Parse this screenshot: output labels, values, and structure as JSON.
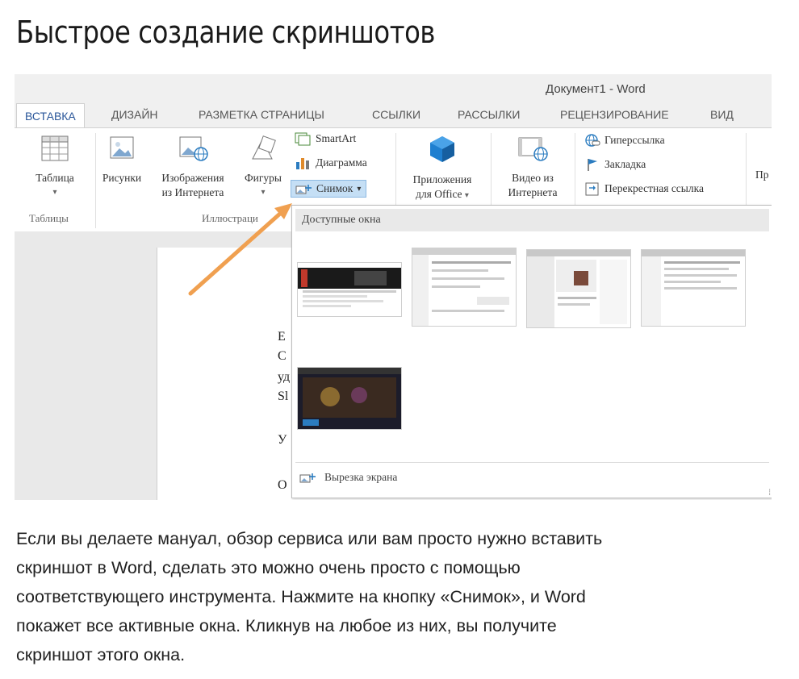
{
  "page_title": "Быстрое создание скриншотов",
  "window": {
    "title": "Документ1 - Word"
  },
  "tabs": [
    "ВСТАВКА",
    "ДИЗАЙН",
    "РАЗМЕТКА СТРАНИЦЫ",
    "ССЫЛКИ",
    "РАССЫЛКИ",
    "РЕЦЕНЗИРОВАНИЕ",
    "ВИД"
  ],
  "ribbon": {
    "table": {
      "label": "Таблица",
      "arrow": "▾",
      "group": "Таблицы"
    },
    "pictures": {
      "label": "Рисунки"
    },
    "online_pictures": {
      "line1": "Изображения",
      "line2": "из Интернета"
    },
    "shapes": {
      "label": "Фигуры",
      "arrow": "▾"
    },
    "smartart": {
      "label": "SmartArt"
    },
    "chart": {
      "label": "Диаграмма"
    },
    "screenshot": {
      "label": "Снимок",
      "arrow": "▾"
    },
    "illustrations_group": "Иллюстраци",
    "apps": {
      "line1": "Приложения",
      "line2": "для Office",
      "arrow": "▾"
    },
    "video": {
      "line1": "Видео из",
      "line2": "Интернета"
    },
    "hyperlink": {
      "label": "Гиперссылка"
    },
    "bookmark": {
      "label": "Закладка"
    },
    "crossref": {
      "label": "Перекрестная ссылка"
    },
    "cut_off": "Пр"
  },
  "document": {
    "lines": [
      "Е",
      "С",
      "уд",
      "Sl",
      "У",
      "О"
    ]
  },
  "dropdown": {
    "header": "Доступные окна",
    "screen_clipping": "Вырезка экрана",
    "grip": "⁞"
  },
  "caption": {
    "lines": [
      "Если вы делаете мануал, обзор сервиса или вам просто нужно вставить",
      "скриншот в Word, сделать это можно очень просто с помощью",
      "соответствующего инструмента. Нажмите на кнопку «Снимок», и Word",
      "покажет все активные окна. Кликнув на любое из них, вы получите",
      "скриншот этого окна."
    ]
  },
  "colors": {
    "accent": "#2b579a",
    "arrow": "#f0a050",
    "apps_icon": "#1e7fd0"
  }
}
